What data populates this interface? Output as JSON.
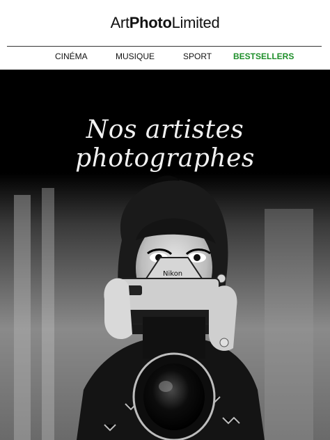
{
  "header": {
    "logo": {
      "part1": "Art",
      "part2": "Photo",
      "part3": "Limited"
    }
  },
  "nav": {
    "items": [
      {
        "label": "CINÉMA"
      },
      {
        "label": "MUSIQUE"
      },
      {
        "label": "SPORT"
      },
      {
        "label": "BESTSELLERS"
      }
    ],
    "accent_color": "#1e8f2a"
  },
  "hero": {
    "title": "Nos artistes photographes",
    "camera_brand": "Nikon"
  }
}
